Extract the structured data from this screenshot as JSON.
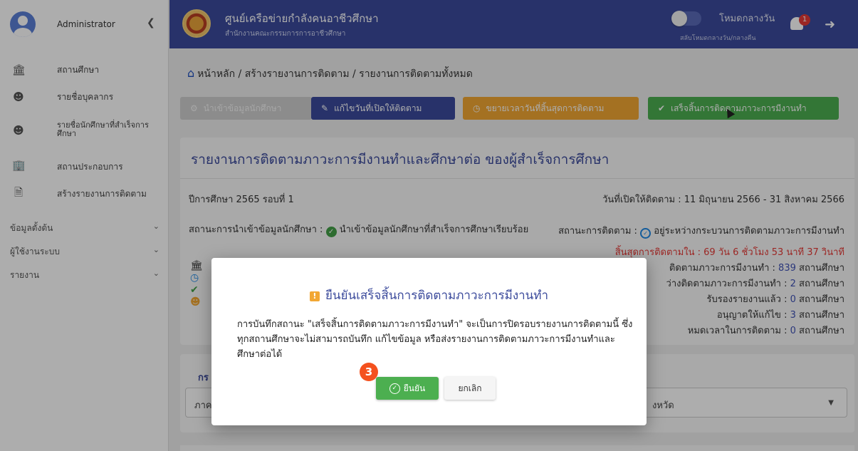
{
  "sidebar": {
    "user": "Administrator",
    "items": [
      {
        "label": "สถานศึกษา",
        "icon": "school-icon"
      },
      {
        "label": "รายชื่อบุคลากร",
        "icon": "people-icon"
      },
      {
        "label": "รายชื่อนักศึกษาที่สำเร็จการศึกษา",
        "icon": "graduates-icon"
      },
      {
        "label": "สถานประกอบการ",
        "icon": "company-icon"
      },
      {
        "label": "สร้างรายงานการติดตาม",
        "icon": "report-file-icon"
      }
    ],
    "groups": [
      "ข้อมูลตั้งต้น",
      "ผู้ใช้งานระบบ",
      "รายงาน"
    ]
  },
  "header": {
    "title": "ศูนย์เครือข่ายกำลังคนอาชีวศึกษา",
    "subtitle": "สำนักงานคณะกรรมการการอาชีวศึกษา",
    "mode_label": "โหมดกลางวัน",
    "mode_sub": "สลับโหมดกลางวัน/กลางคืน",
    "notification_count": "1"
  },
  "breadcrumb": "หน้าหลัก / สร้างรายงานการติดตาม / รายงานการติดตามทั้งหมด",
  "toolbar": {
    "import": "นำเข้าข้อมูลนักศึกษา",
    "edit_open": "แก้ไขวันที่เปิดให้ติดตาม",
    "extend": "ขยายเวลาวันที่สิ้นสุดการติดตาม",
    "finish": "เสร็จสิ้นการติดตามภาวะการมีงานทำ"
  },
  "report": {
    "title": "รายงานการติดตามภาวะการมีงานทำและศึกษาต่อ ของผู้สำเร็จการศึกษา",
    "year": "ปีการศึกษา 2565 รอบที่ 1",
    "open_date": "วันที่เปิดให้ติดตาม : 11 มิถุนายน 2566 - 31 สิงหาคม 2566",
    "import_status_label": "สถานะการนำเข้าข้อมูลนักศึกษา :",
    "import_status_value": "นำเข้าข้อมูลนักศึกษาที่สำเร็จการศึกษาเรียบร้อย",
    "follow_status_label": "สถานะการติดตาม :",
    "follow_status_value": "อยู่ระหว่างกระบวนการติดตามภาวะการมีงานทำ",
    "deadline": "สิ้นสุดการติดตามใน : 69 วัน 6 ชั่วโมง 53 นาที 37 วินาที",
    "stats": [
      {
        "label": "ติดตามภาวะการมีงานทำ :",
        "num": "839",
        "unit": "สถานศึกษา"
      },
      {
        "label": "ว่างติดตามภาวะการมีงานทำ :",
        "num": "2",
        "unit": "สถานศึกษา"
      },
      {
        "label": "รับรองรายงานแล้ว :",
        "num": "0",
        "unit": "สถานศึกษา"
      },
      {
        "label": "อนุญาตให้แก้ไข :",
        "num": "3",
        "unit": "สถานศึกษา"
      },
      {
        "label": "หมดเวลาในการติดตาม :",
        "num": "0",
        "unit": "สถานศึกษา"
      }
    ]
  },
  "filter": {
    "title_partial": "กร",
    "region_partial": "ภาค",
    "province_partial": "งหวัด"
  },
  "dialog": {
    "title": "ยืนยันเสร็จสิ้นการติดตามภาวะการมีงานทำ",
    "body": "การบันทึกสถานะ \"เสร็จสิ้นการติดตามภาวะการมีงานทำ\" จะเป็นการปิดรอบรายงานการติดตามนี้ ซึ่งทุกสถานศึกษาจะไม่สามารถบันทึก แก้ไขข้อมูล หรือส่งรายงานการติดตามภาวะการมีงานทำและศึกษาต่อได้",
    "step": "3",
    "confirm": "ยืนยัน",
    "cancel": "ยกเลิก"
  }
}
